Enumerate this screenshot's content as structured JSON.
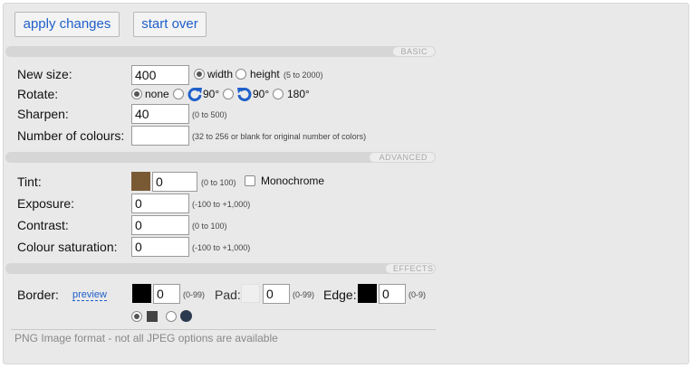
{
  "toolbar": {
    "apply_label": "apply changes",
    "start_over_label": "start over"
  },
  "sections": {
    "basic": "BASIC",
    "advanced": "ADVANCED",
    "effects": "EFFECTS"
  },
  "basic": {
    "new_size_label": "New size:",
    "new_size_value": "400",
    "width_label": "width",
    "height_label": "height",
    "size_hint": "(5 to 2000)",
    "size_selected": "width",
    "rotate_label": "Rotate:",
    "rotate_none": "none",
    "rotate_cw": "90°",
    "rotate_ccw": "90°",
    "rotate_180": "180°",
    "rotate_selected": "none",
    "sharpen_label": "Sharpen:",
    "sharpen_value": "40",
    "sharpen_hint": "(0 to 500)",
    "colours_label": "Number of colours:",
    "colours_value": "",
    "colours_hint": "(32 to 256 or blank for original number of colors)"
  },
  "advanced": {
    "tint_label": "Tint:",
    "tint_color": "#7a5a35",
    "tint_value": "0",
    "tint_hint": "(0 to 100)",
    "monochrome_label": "Monochrome",
    "monochrome_checked": false,
    "exposure_label": "Exposure:",
    "exposure_value": "0",
    "exposure_hint": "(-100 to +1,000)",
    "contrast_label": "Contrast:",
    "contrast_value": "0",
    "contrast_hint": "(0 to 100)",
    "saturation_label": "Colour saturation:",
    "saturation_value": "0",
    "saturation_hint": "(-100 to +1,000)"
  },
  "effects": {
    "border_label": "Border:",
    "preview_label": "preview",
    "border_color": "#000000",
    "border_value": "0",
    "border_hint": "(0-99)",
    "pad_label": "Pad:",
    "pad_color": "#efefef",
    "pad_value": "0",
    "pad_hint": "(0-99)",
    "edge_label": "Edge:",
    "edge_color": "#000000",
    "edge_value": "0",
    "edge_hint": "(0-9)",
    "corner_selected": "square",
    "corner_square_color": "#444444",
    "corner_round_color": "#2c3a4f"
  },
  "footer": {
    "note": "PNG Image format - not all JPEG options are available"
  },
  "colors": {
    "accent": "#1f5fc9",
    "rotate_icon": "#1f5fc9"
  }
}
